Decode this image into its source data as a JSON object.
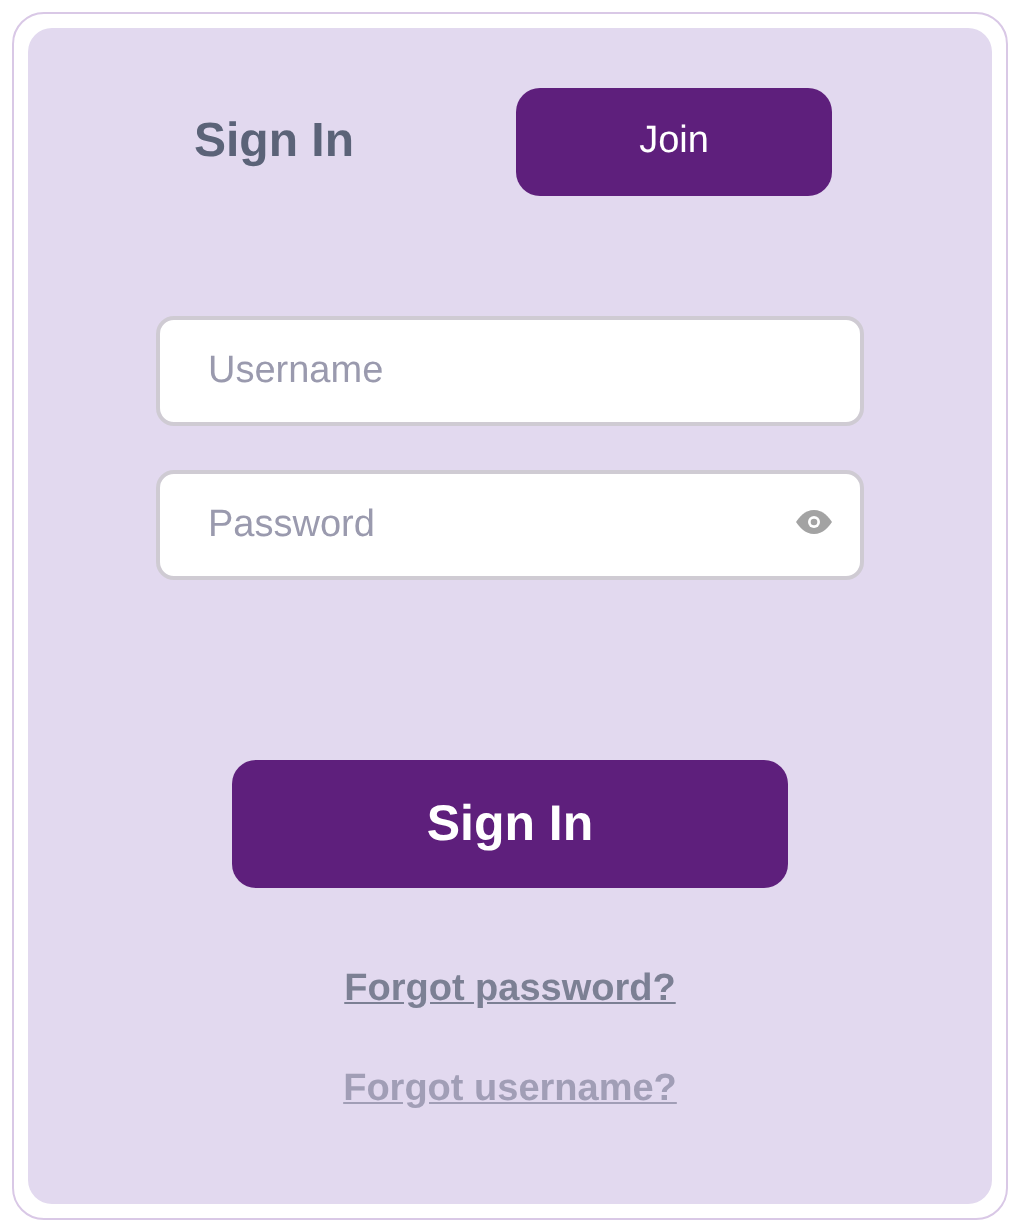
{
  "tabs": [
    {
      "label": "Sign In",
      "selected": true
    },
    {
      "label": "Join",
      "selected": false
    }
  ],
  "fields": [
    {
      "placeholder": "Username",
      "kind": "text"
    },
    {
      "placeholder": "Password",
      "kind": "password"
    }
  ],
  "submit": {
    "label": "Sign In"
  },
  "links": [
    {
      "label": "Forgot password?",
      "disabled": false
    },
    {
      "label": "Forgot username?",
      "disabled": true
    }
  ]
}
